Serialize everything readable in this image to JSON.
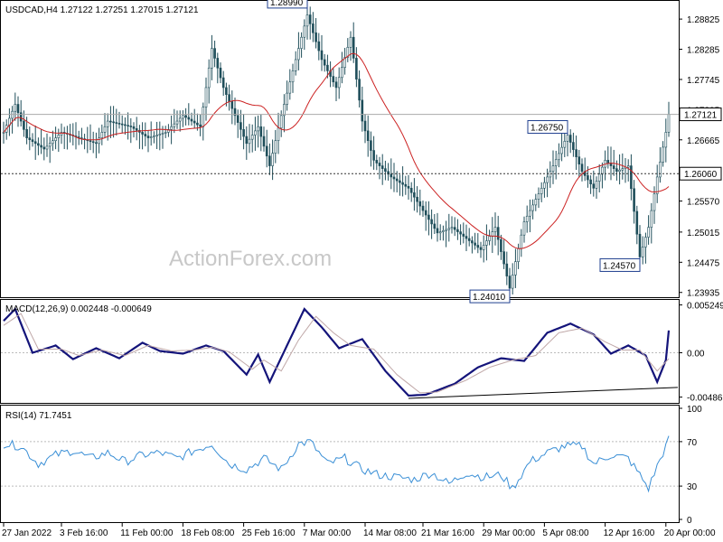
{
  "chart_data": [
    {
      "type": "candlestick",
      "symbol_label": "USDCAD,H4",
      "ohlc_label": "1.27122 1.27251 1.27015 1.27121",
      "watermark": "ActionForex.com",
      "y_ticks": [
        "1.28825",
        "1.28285",
        "1.27745",
        "1.27205",
        "1.26665",
        "1.26125",
        "1.25570",
        "1.25015",
        "1.24475",
        "1.23935"
      ],
      "y_tick_values": [
        1.28825,
        1.28285,
        1.27745,
        1.27205,
        1.26665,
        1.26125,
        1.2557,
        1.25015,
        1.24475,
        1.23935
      ],
      "ylim": [
        1.2385,
        1.2915
      ],
      "current_price": "1.27121",
      "current_price_value": 1.27121,
      "level_line": "1.26060",
      "level_line_value": 1.2606,
      "annotations": [
        {
          "text": "1.28990",
          "index": 105,
          "value": 1.2899
        },
        {
          "text": "1.26750",
          "index": 195,
          "value": 1.2675
        },
        {
          "text": "1.24010",
          "index": 175,
          "value": 1.2401
        },
        {
          "text": "1.24570",
          "index": 220,
          "value": 1.2457
        }
      ],
      "x_labels": [
        "27 Jan 2022",
        "3 Feb 16:00",
        "11 Feb 00:00",
        "18 Feb 08:00",
        "25 Feb 16:00",
        "7 Mar 00:00",
        "14 Mar 08:00",
        "21 Mar 16:00",
        "29 Mar 00:00",
        "5 Apr 08:00",
        "12 Apr 16:00",
        "20 Apr 00:00"
      ],
      "x_label_index": [
        0,
        20,
        41,
        62,
        83,
        104,
        125,
        145,
        166,
        187,
        208,
        229
      ],
      "keyframes": [
        [
          0,
          1.268
        ],
        [
          4,
          1.273
        ],
        [
          8,
          1.267
        ],
        [
          14,
          1.265
        ],
        [
          20,
          1.268
        ],
        [
          26,
          1.267
        ],
        [
          32,
          1.266
        ],
        [
          36,
          1.27
        ],
        [
          44,
          1.269
        ],
        [
          50,
          1.267
        ],
        [
          56,
          1.268
        ],
        [
          62,
          1.271
        ],
        [
          68,
          1.269
        ],
        [
          72,
          1.283
        ],
        [
          76,
          1.276
        ],
        [
          80,
          1.271
        ],
        [
          84,
          1.266
        ],
        [
          88,
          1.269
        ],
        [
          92,
          1.262
        ],
        [
          96,
          1.271
        ],
        [
          102,
          1.283
        ],
        [
          105,
          1.289
        ],
        [
          110,
          1.281
        ],
        [
          115,
          1.276
        ],
        [
          120,
          1.285
        ],
        [
          124,
          1.27
        ],
        [
          128,
          1.263
        ],
        [
          134,
          1.26
        ],
        [
          140,
          1.258
        ],
        [
          145,
          1.254
        ],
        [
          150,
          1.25
        ],
        [
          155,
          1.251
        ],
        [
          160,
          1.249
        ],
        [
          165,
          1.247
        ],
        [
          170,
          1.251
        ],
        [
          175,
          1.2401
        ],
        [
          180,
          1.252
        ],
        [
          185,
          1.257
        ],
        [
          190,
          1.262
        ],
        [
          195,
          1.2675
        ],
        [
          200,
          1.261
        ],
        [
          204,
          1.258
        ],
        [
          208,
          1.263
        ],
        [
          212,
          1.261
        ],
        [
          216,
          1.262
        ],
        [
          220,
          1.2457
        ],
        [
          223,
          1.251
        ],
        [
          226,
          1.26
        ],
        [
          229,
          1.268
        ],
        [
          230,
          1.27121
        ]
      ]
    },
    {
      "type": "line",
      "label": "MACD(12,26,9) 0.002448 -0.000649",
      "y_ticks": [
        "0.005249",
        "0.00",
        "-0.004865"
      ],
      "y_tick_values": [
        0.005249,
        0.0,
        -0.004865
      ],
      "ylim": [
        -0.0055,
        0.0058
      ],
      "series": [
        {
          "name": "MACD",
          "keyframes": [
            [
              0,
              0.0035
            ],
            [
              4,
              0.0048
            ],
            [
              10,
              0.0
            ],
            [
              18,
              0.0008
            ],
            [
              24,
              -0.0007
            ],
            [
              32,
              0.0005
            ],
            [
              40,
              -0.0006
            ],
            [
              48,
              0.0011
            ],
            [
              54,
              0.0002
            ],
            [
              62,
              -0.0001
            ],
            [
              70,
              0.0008
            ],
            [
              76,
              0.0002
            ],
            [
              84,
              -0.0024
            ],
            [
              88,
              -0.0002
            ],
            [
              92,
              -0.0032
            ],
            [
              98,
              0.0008
            ],
            [
              104,
              0.0048
            ],
            [
              110,
              0.0028
            ],
            [
              116,
              0.0005
            ],
            [
              124,
              0.0015
            ],
            [
              132,
              -0.002
            ],
            [
              140,
              -0.0047
            ],
            [
              146,
              -0.0046
            ],
            [
              156,
              -0.0034
            ],
            [
              164,
              -0.0016
            ],
            [
              172,
              -0.0006
            ],
            [
              180,
              -0.0009
            ],
            [
              188,
              0.0022
            ],
            [
              196,
              0.0032
            ],
            [
              204,
              0.002
            ],
            [
              210,
              -0.0001
            ],
            [
              216,
              0.0008
            ],
            [
              222,
              -0.0003
            ],
            [
              226,
              -0.0032
            ],
            [
              229,
              -0.0008
            ],
            [
              230,
              0.002448
            ]
          ]
        },
        {
          "name": "Signal",
          "keyframes": [
            [
              0,
              0.003
            ],
            [
              6,
              0.0043
            ],
            [
              12,
              0.0004
            ],
            [
              20,
              0.0004
            ],
            [
              26,
              -0.0003
            ],
            [
              34,
              0.0003
            ],
            [
              42,
              -0.0003
            ],
            [
              50,
              0.0008
            ],
            [
              58,
              0.0002
            ],
            [
              66,
              0.0003
            ],
            [
              72,
              0.0006
            ],
            [
              78,
              0.0001
            ],
            [
              86,
              -0.0018
            ],
            [
              90,
              -0.0008
            ],
            [
              96,
              -0.002
            ],
            [
              102,
              0.0014
            ],
            [
              108,
              0.004
            ],
            [
              114,
              0.0022
            ],
            [
              120,
              0.0008
            ],
            [
              128,
              0.0004
            ],
            [
              136,
              -0.0024
            ],
            [
              144,
              -0.0044
            ],
            [
              150,
              -0.0043
            ],
            [
              160,
              -0.003
            ],
            [
              168,
              -0.0016
            ],
            [
              176,
              -0.0008
            ],
            [
              184,
              -0.0003
            ],
            [
              192,
              0.0022
            ],
            [
              200,
              0.0027
            ],
            [
              208,
              0.0012
            ],
            [
              214,
              0.0003
            ],
            [
              220,
              0.0003
            ],
            [
              226,
              -0.002
            ],
            [
              230,
              -0.000649
            ]
          ]
        },
        {
          "name": "Trendline",
          "keyframes": [
            [
              140,
              -0.005
            ],
            [
              230,
              -0.0038
            ]
          ]
        }
      ]
    },
    {
      "type": "line",
      "label": "RSI(14) 71.7451",
      "y_ticks": [
        "100",
        "70",
        "30",
        "0"
      ],
      "y_tick_values": [
        100,
        70,
        30,
        0
      ],
      "ylim": [
        0,
        100
      ],
      "guides": [
        70,
        30
      ],
      "series": [
        {
          "name": "RSI",
          "keyframes": [
            [
              0,
              68
            ],
            [
              6,
              66
            ],
            [
              12,
              50
            ],
            [
              18,
              58
            ],
            [
              24,
              62
            ],
            [
              30,
              55
            ],
            [
              36,
              60
            ],
            [
              42,
              52
            ],
            [
              48,
              58
            ],
            [
              54,
              60
            ],
            [
              60,
              55
            ],
            [
              66,
              62
            ],
            [
              72,
              68
            ],
            [
              78,
              50
            ],
            [
              84,
              45
            ],
            [
              90,
              55
            ],
            [
              96,
              45
            ],
            [
              102,
              68
            ],
            [
              106,
              70
            ],
            [
              112,
              50
            ],
            [
              118,
              55
            ],
            [
              124,
              45
            ],
            [
              130,
              40
            ],
            [
              136,
              38
            ],
            [
              142,
              36
            ],
            [
              148,
              42
            ],
            [
              154,
              32
            ],
            [
              160,
              42
            ],
            [
              166,
              38
            ],
            [
              172,
              40
            ],
            [
              176,
              28
            ],
            [
              182,
              52
            ],
            [
              188,
              60
            ],
            [
              194,
              66
            ],
            [
              200,
              66
            ],
            [
              204,
              50
            ],
            [
              210,
              58
            ],
            [
              216,
              55
            ],
            [
              220,
              40
            ],
            [
              223,
              28
            ],
            [
              226,
              48
            ],
            [
              230,
              71.7451
            ]
          ]
        }
      ]
    }
  ]
}
